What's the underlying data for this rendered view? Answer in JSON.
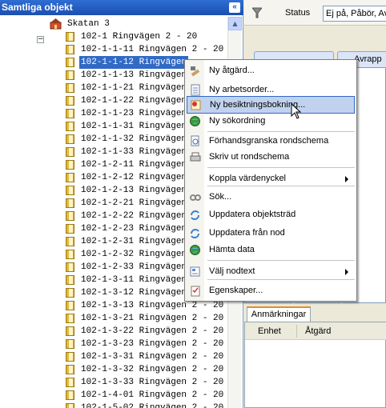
{
  "left_panel": {
    "title": "Samtliga objekt",
    "collapse_glyph": "«"
  },
  "tree": {
    "root_label": "Skatan 3",
    "expander_glyph": "−",
    "nodes": [
      {
        "label": "102-1 Ringvägen 2 - 20"
      },
      {
        "label": "102-1-1-11 Ringvägen 2 - 20"
      },
      {
        "label": "102-1-1-12 Ringvägen",
        "selected": true
      },
      {
        "label": "102-1-1-13 Ringvägen"
      },
      {
        "label": "102-1-1-21 Ringvägen"
      },
      {
        "label": "102-1-1-22 Ringvägen"
      },
      {
        "label": "102-1-1-23 Ringvägen"
      },
      {
        "label": "102-1-1-31 Ringvägen"
      },
      {
        "label": "102-1-1-32 Ringvägen"
      },
      {
        "label": "102-1-1-33 Ringvägen"
      },
      {
        "label": "102-1-2-11 Ringvägen"
      },
      {
        "label": "102-1-2-12 Ringvägen"
      },
      {
        "label": "102-1-2-13 Ringvägen"
      },
      {
        "label": "102-1-2-21 Ringvägen"
      },
      {
        "label": "102-1-2-22 Ringvägen"
      },
      {
        "label": "102-1-2-23 Ringvägen"
      },
      {
        "label": "102-1-2-31 Ringvägen"
      },
      {
        "label": "102-1-2-32 Ringvägen"
      },
      {
        "label": "102-1-2-33 Ringvägen"
      },
      {
        "label": "102-1-3-11 Ringvägen"
      },
      {
        "label": "102-1-3-12 Ringvägen"
      },
      {
        "label": "102-1-3-13 Ringvägen 2 - 20"
      },
      {
        "label": "102-1-3-21 Ringvägen 2 - 20"
      },
      {
        "label": "102-1-3-22 Ringvägen 2 - 20"
      },
      {
        "label": "102-1-3-23 Ringvägen 2 - 20"
      },
      {
        "label": "102-1-3-31 Ringvägen 2 - 20"
      },
      {
        "label": "102-1-3-32 Ringvägen 2 - 20"
      },
      {
        "label": "102-1-3-33 Ringvägen 2 - 20"
      },
      {
        "label": "102-1-4-01 Ringvägen 2 - 20"
      },
      {
        "label": "102-1-5-02 Ringvägen 2 - 20"
      }
    ]
  },
  "filter": {
    "status_label": "Status",
    "status_value": "Ej på, Påbör, Av"
  },
  "right_tabs": [
    {
      "label": "",
      "icon": "tab-icon"
    },
    {
      "label": "Avrapp",
      "icon": "tab-icon"
    }
  ],
  "bottom": {
    "tab_label": "Anmärkningar",
    "columns": [
      "Enhet",
      "Åtgärd"
    ]
  },
  "context_menu": {
    "items": [
      {
        "label": "Ny åtgärd...",
        "icon": "hammer-icon"
      },
      {
        "label": "Ny arbetsorder...",
        "icon": "document-icon"
      },
      {
        "label": "Ny besiktningsbokning...",
        "icon": "booking-icon",
        "highlighted": true
      },
      {
        "label": "Ny sökordning",
        "icon": "globe-icon"
      },
      {
        "label": "Förhandsgranska rondschema",
        "icon": "preview-icon"
      },
      {
        "label": "Skriv ut rondschema",
        "icon": "printer-icon"
      },
      {
        "label": "Koppla värdenyckel",
        "icon": "",
        "submenu": true
      },
      {
        "label": "Sök...",
        "icon": "search-icon"
      },
      {
        "label": "Uppdatera objektsträd",
        "icon": "refresh-icon"
      },
      {
        "label": "Uppdatera från nod",
        "icon": "refresh-icon"
      },
      {
        "label": "Hämta data",
        "icon": "globe-icon"
      },
      {
        "label": "Välj nodtext",
        "icon": "nodetext-icon",
        "submenu": true
      },
      {
        "label": "Egenskaper...",
        "icon": "properties-icon"
      }
    ]
  },
  "colors": {
    "header_blue": "#2f6ed3",
    "selection": "#316ac5",
    "menu_highlight": "#c1d2ee",
    "tab_accent": "#e68b2c"
  }
}
